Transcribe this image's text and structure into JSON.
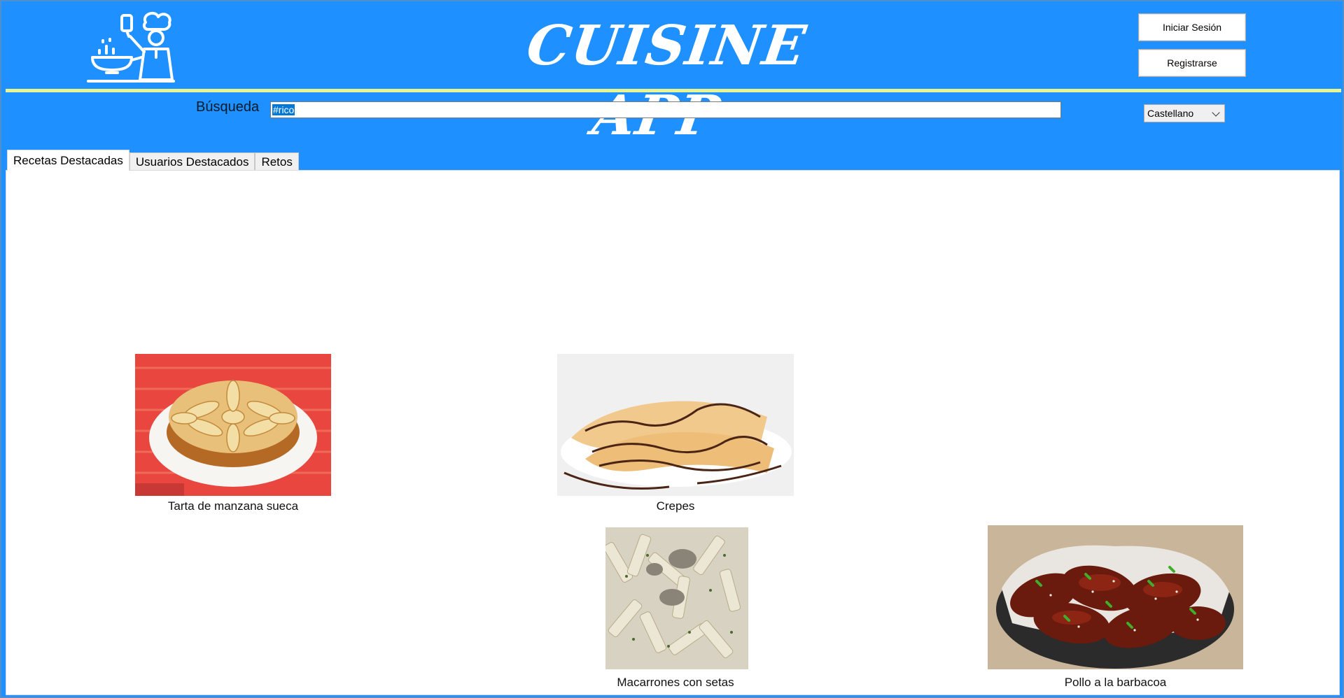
{
  "header": {
    "app_title": "CUISINE APP",
    "login_label": "Iniciar Sesión",
    "register_label": "Registrarse",
    "logo_icon": "chef-cooking-icon"
  },
  "search": {
    "label": "Búsqueda",
    "value": "#rico"
  },
  "language": {
    "selected": "Castellano"
  },
  "tabs": [
    {
      "label": "Recetas Destacadas",
      "active": true
    },
    {
      "label": "Usuarios Destacados",
      "active": false
    },
    {
      "label": "Retos",
      "active": false
    }
  ],
  "recipes": [
    {
      "name": "Tarta de manzana sueca",
      "image": "apple-cake-image"
    },
    {
      "name": "Crepes",
      "image": "crepes-image"
    },
    {
      "name": "Macarrones con setas",
      "image": "pasta-mushrooms-image"
    },
    {
      "name": "Pollo a la barbacoa",
      "image": "bbq-chicken-image"
    }
  ],
  "colors": {
    "header_bg": "#1e90ff",
    "divider": "#e8f596",
    "selection": "#0078d7"
  }
}
